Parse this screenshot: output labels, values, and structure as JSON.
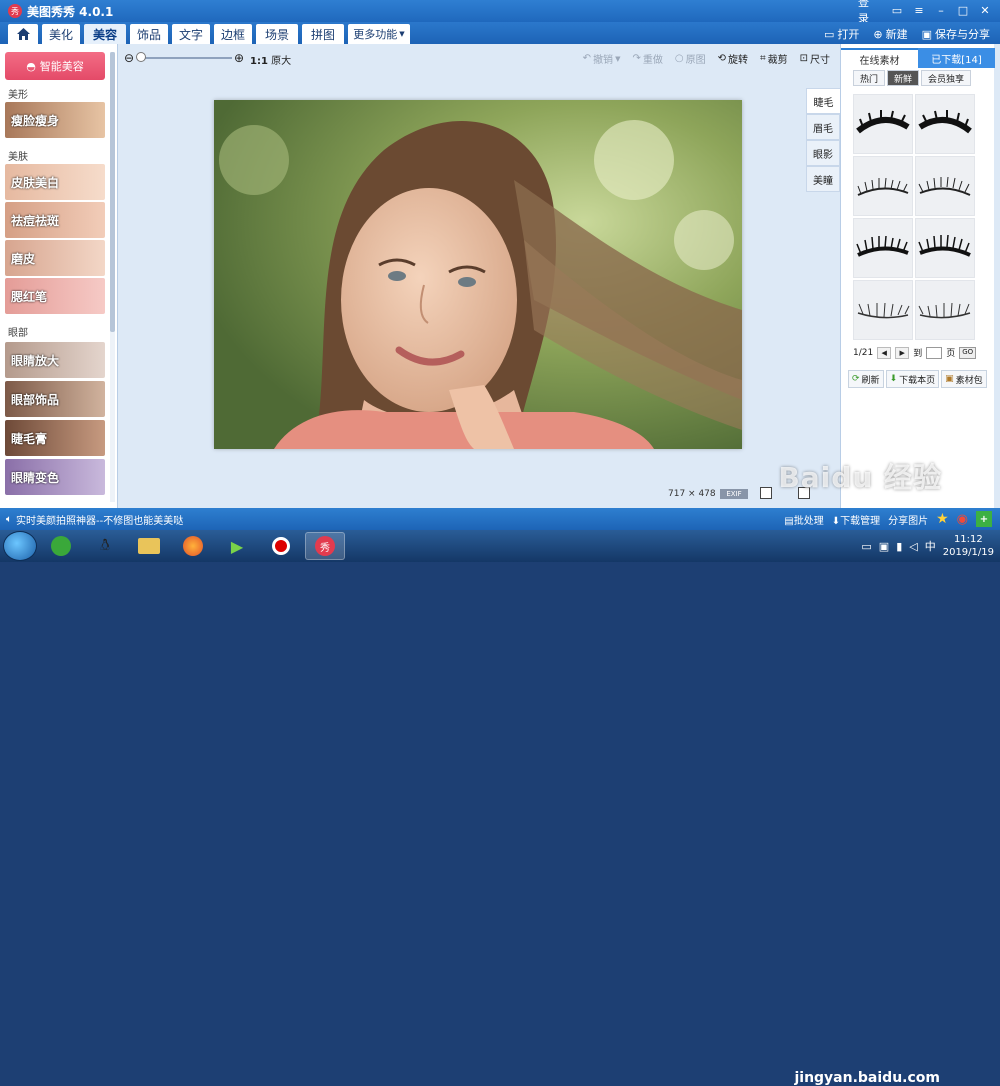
{
  "window": {
    "title": "美图秀秀 4.0.1",
    "login": "登录"
  },
  "menu": {
    "tabs": [
      "美化",
      "美容",
      "饰品",
      "文字",
      "边框",
      "场景",
      "拼图",
      "更多功能"
    ],
    "active": "美容",
    "actions": {
      "open": "打开",
      "new": "新建",
      "save": "保存与分享"
    }
  },
  "left": {
    "smart_button": "智能美容",
    "sections": {
      "shape": "美形",
      "skin": "美肤",
      "eyes": "眼部"
    },
    "features": [
      "瘦脸瘦身",
      "皮肤美白",
      "祛痘祛斑",
      "磨皮",
      "腮红笔",
      "眼睛放大",
      "眼部饰品",
      "睫毛膏",
      "眼睛变色"
    ]
  },
  "toolbar": {
    "ratio": "1:1",
    "original": "原大",
    "undo": "撤销",
    "redo": "重做",
    "restore": "原图",
    "rotate": "旋转",
    "crop": "裁剪",
    "size": "尺寸"
  },
  "image": {
    "width": "717",
    "height": "478",
    "exif": "EXIF"
  },
  "right": {
    "tabs": {
      "online": "在线素材",
      "downloaded": "已下载[14]"
    },
    "chips": [
      "热门",
      "新鲜",
      "会员独享"
    ],
    "selected_chip": "新鲜",
    "vtabs": [
      "睫毛",
      "眉毛",
      "眼影",
      "美瞳"
    ],
    "selected_vtab": "睫毛",
    "pager": {
      "page": "1/21",
      "to": "到",
      "unit": "页",
      "go": "GO"
    },
    "buttons": {
      "refresh": "刷新",
      "download_page": "下载本页",
      "pack": "素材包"
    }
  },
  "status": {
    "message": "实时美颜拍照神器--不修图也能美美哒",
    "batch": "批处理",
    "download_manage": "下载管理",
    "share": "分享图片"
  },
  "taskbar": {
    "time": "11:12",
    "date": "2019/1/19",
    "watermark": "Baidu 经验",
    "url": "jingyan.baidu.com"
  },
  "colors": {
    "accent": "#1f68bd",
    "pink": "#e44a68"
  }
}
